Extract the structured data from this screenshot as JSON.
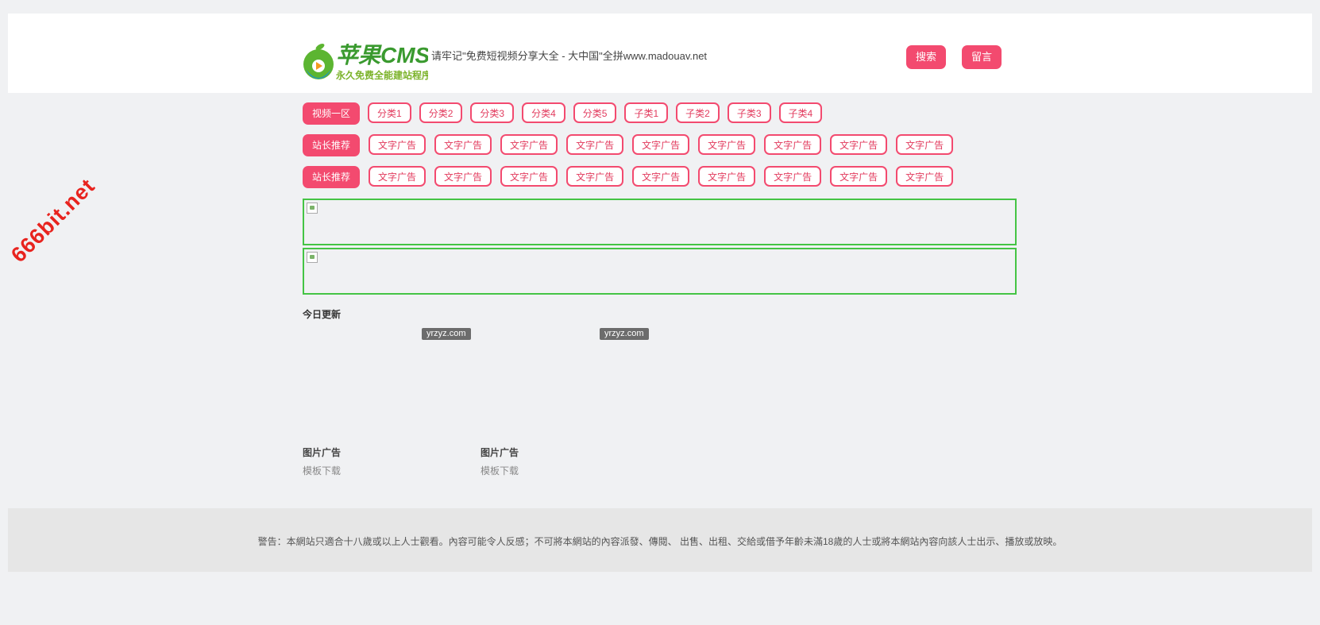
{
  "header": {
    "logo_text": "苹果CMS",
    "logo_subtitle": "永久免费全能建站程序",
    "slogan": "请牢记\"免费短视频分享大全 - 大中国\"全拼www.madouav.net",
    "search_label": "搜索",
    "message_label": "留言"
  },
  "nav": {
    "categories": [
      "视频一区",
      "分类1",
      "分类2",
      "分类3",
      "分类4",
      "分类5",
      "子类1",
      "子类2",
      "子类3",
      "子类4"
    ],
    "recommend_rows": [
      {
        "label": "站长推荐",
        "ads": [
          "文字广告",
          "文字广告",
          "文字广告",
          "文字广告",
          "文字广告",
          "文字广告",
          "文字广告",
          "文字广告",
          "文字广告"
        ]
      },
      {
        "label": "站长推荐",
        "ads": [
          "文字广告",
          "文字广告",
          "文字广告",
          "文字广告",
          "文字广告",
          "文字广告",
          "文字广告",
          "文字广告",
          "文字广告"
        ]
      }
    ]
  },
  "main": {
    "today_title": "今日更新",
    "badges": [
      "yrzyz.com",
      "yrzyz.com"
    ],
    "image_ads": [
      {
        "title": "图片广告",
        "link": "模板下载"
      },
      {
        "title": "图片广告",
        "link": "模板下载"
      }
    ]
  },
  "footer": {
    "warning": "警告：本網站只適合十八歲或以上人士觀看。內容可能令人反感；不可將本網站的內容派發、傳閱、 出售、出租、交給或借予年齡未滿18歲的人士或將本網站內容向該人士出示、播放或放映。"
  },
  "watermark": "666bit.net",
  "colors": {
    "accent": "#f34a6f",
    "banner_border": "#44c444",
    "watermark": "#e8231e"
  }
}
